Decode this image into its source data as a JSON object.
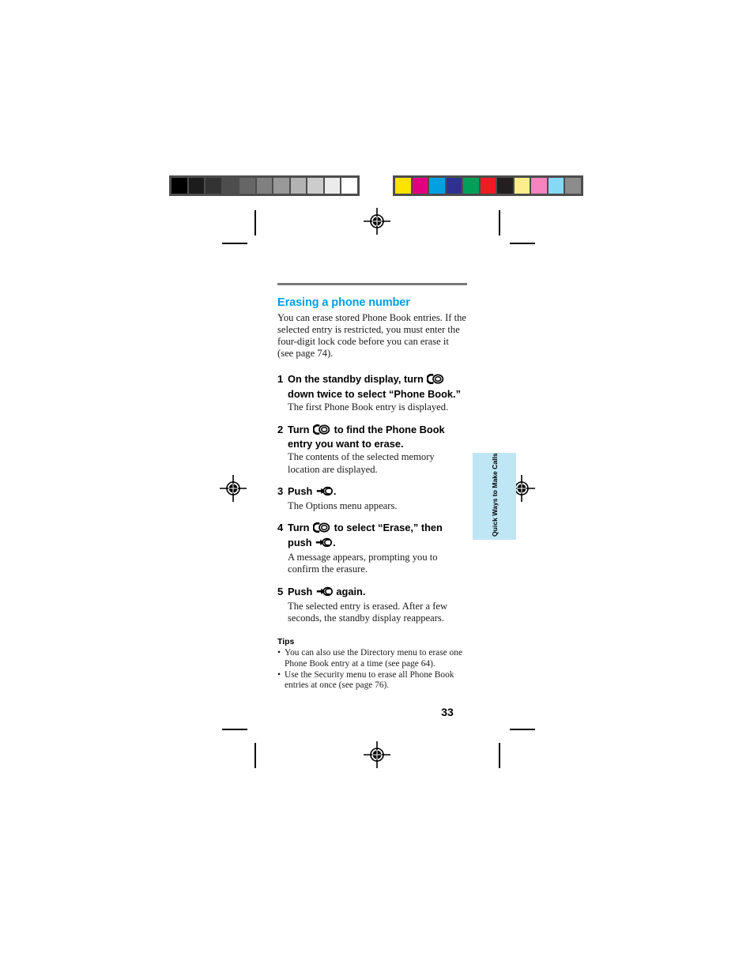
{
  "page": {
    "folio": "33",
    "side_tab_label": "Quick Ways to Make Calls"
  },
  "section": {
    "heading": "Erasing a phone number",
    "intro": "You can erase stored Phone Book entries. If the selected entry is restricted, you must enter the four-digit lock code before you can erase it (see page 74)."
  },
  "steps": [
    {
      "num": "1",
      "title_before": "On the standby display, turn ",
      "icon": "jog-dial-turn-icon",
      "title_after": " down twice to select “Phone Book.”",
      "desc": "The first Phone Book entry is displayed."
    },
    {
      "num": "2",
      "title_before": "Turn ",
      "icon": "jog-dial-turn-icon",
      "title_after": " to find the Phone Book entry you want to erase.",
      "desc": "The contents of the selected memory location are displayed."
    },
    {
      "num": "3",
      "title_before": "Push ",
      "icon": "jog-dial-push-icon",
      "title_after": ".",
      "desc": "The Options menu appears."
    },
    {
      "num": "4",
      "title_before": "Turn ",
      "icon": "jog-dial-turn-icon",
      "title_mid": " to select “Erase,” then push ",
      "icon2": "jog-dial-push-icon",
      "title_after": ".",
      "desc": "A message appears, prompting you to confirm the erasure."
    },
    {
      "num": "5",
      "title_before": "Push ",
      "icon": "jog-dial-push-icon",
      "title_after": " again.",
      "desc": "The selected entry is erased. After a few seconds, the standby display reappears."
    }
  ],
  "tips": {
    "label": "Tips",
    "bullet": "•",
    "items": [
      "You can also use the Directory menu to erase one Phone Book entry at a time (see page 64).",
      "Use the Security menu to erase all Phone Book entries at once (see page 76)."
    ]
  },
  "calibration": {
    "grayscale_label": "grayscale-calibration-strip",
    "color_label": "color-calibration-strip",
    "grayscale_patches": [
      "#000000",
      "#1c1c1c",
      "#333333",
      "#4d4d4d",
      "#666666",
      "#808080",
      "#999999",
      "#b3b3b3",
      "#cccccc",
      "#ebebeb",
      "#ffffff"
    ],
    "color_patches": [
      "#fde300",
      "#e3007f",
      "#00a0e3",
      "#2e3192",
      "#00a05a",
      "#ed1c24",
      "#231f20",
      "#fcee8c",
      "#f584c0",
      "#84d9f5",
      "#8c8c8c"
    ]
  },
  "marks": {
    "registration_label": "registration-target-mark",
    "crop_label": "crop-mark"
  }
}
